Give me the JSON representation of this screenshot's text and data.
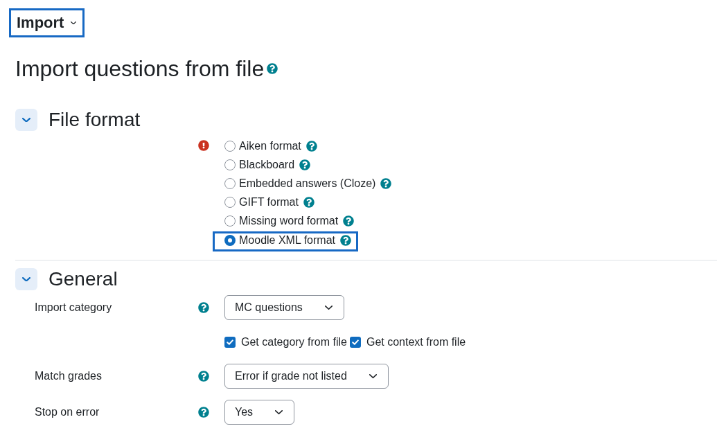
{
  "page_menu": {
    "label": "Import",
    "highlighted": true
  },
  "page_title": "Import questions from file",
  "sections": [
    {
      "title": "File format",
      "expanded": true,
      "fields": [
        {
          "kind": "radio_group",
          "required": true,
          "options": [
            {
              "label": "Aiken format",
              "selected": false,
              "highlighted": false
            },
            {
              "label": "Blackboard",
              "selected": false,
              "highlighted": false
            },
            {
              "label": "Embedded answers (Cloze)",
              "selected": false,
              "highlighted": false
            },
            {
              "label": "GIFT format",
              "selected": false,
              "highlighted": false
            },
            {
              "label": "Missing word format",
              "selected": false,
              "highlighted": false
            },
            {
              "label": "Moodle XML format",
              "selected": true,
              "highlighted": true
            }
          ]
        }
      ]
    },
    {
      "title": "General",
      "expanded": true,
      "fields": [
        {
          "kind": "select",
          "label": "Import category",
          "value": "MC questions"
        },
        {
          "kind": "checkboxes",
          "options": [
            {
              "label": "Get category from file",
              "checked": true
            },
            {
              "label": "Get context from file",
              "checked": true
            }
          ]
        },
        {
          "kind": "select",
          "label": "Match grades",
          "value": "Error if grade not listed"
        },
        {
          "kind": "select",
          "label": "Stop on error",
          "value": "Yes"
        }
      ]
    }
  ]
}
